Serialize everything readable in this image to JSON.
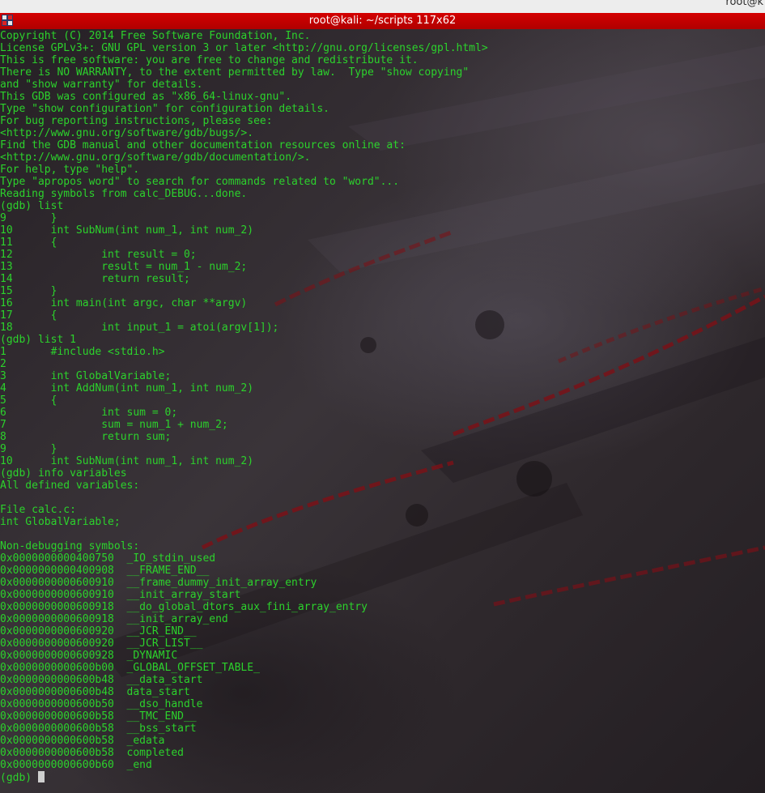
{
  "desktop": {
    "top_right_text": "root@k"
  },
  "window": {
    "title": "root@kali: ~/scripts 117x62",
    "icon": "terminal-icon",
    "titlebar_color": "#c80000"
  },
  "terminal": {
    "text_color": "#2cd22c",
    "lines": [
      "Copyright (C) 2014 Free Software Foundation, Inc.",
      "License GPLv3+: GNU GPL version 3 or later <http://gnu.org/licenses/gpl.html>",
      "This is free software: you are free to change and redistribute it.",
      "There is NO WARRANTY, to the extent permitted by law.  Type \"show copying\"",
      "and \"show warranty\" for details.",
      "This GDB was configured as \"x86_64-linux-gnu\".",
      "Type \"show configuration\" for configuration details.",
      "For bug reporting instructions, please see:",
      "<http://www.gnu.org/software/gdb/bugs/>.",
      "Find the GDB manual and other documentation resources online at:",
      "<http://www.gnu.org/software/gdb/documentation/>.",
      "For help, type \"help\".",
      "Type \"apropos word\" to search for commands related to \"word\"...",
      "Reading symbols from calc_DEBUG...done.",
      "(gdb) list",
      "9\t}",
      "10\tint SubNum(int num_1, int num_2)",
      "11\t{",
      "12\t\tint result = 0;",
      "13\t\tresult = num_1 - num_2;",
      "14\t\treturn result;",
      "15\t}",
      "16\tint main(int argc, char **argv)",
      "17\t{",
      "18\t\tint input_1 = atoi(argv[1]);",
      "(gdb) list 1",
      "1\t#include <stdio.h>",
      "2",
      "3\tint GlobalVariable;",
      "4\tint AddNum(int num_1, int num_2)",
      "5\t{",
      "6\t\tint sum = 0;",
      "7\t\tsum = num_1 + num_2;",
      "8\t\treturn sum;",
      "9\t}",
      "10\tint SubNum(int num_1, int num_2)",
      "(gdb) info variables",
      "All defined variables:",
      "",
      "File calc.c:",
      "int GlobalVariable;",
      "",
      "Non-debugging symbols:",
      "0x0000000000400750  _IO_stdin_used",
      "0x0000000000400908  __FRAME_END__",
      "0x0000000000600910  __frame_dummy_init_array_entry",
      "0x0000000000600910  __init_array_start",
      "0x0000000000600918  __do_global_dtors_aux_fini_array_entry",
      "0x0000000000600918  __init_array_end",
      "0x0000000000600920  __JCR_END__",
      "0x0000000000600920  __JCR_LIST__",
      "0x0000000000600928  _DYNAMIC",
      "0x0000000000600b00  _GLOBAL_OFFSET_TABLE_",
      "0x0000000000600b48  __data_start",
      "0x0000000000600b48  data_start",
      "0x0000000000600b50  __dso_handle",
      "0x0000000000600b58  __TMC_END__",
      "0x0000000000600b58  __bss_start",
      "0x0000000000600b58  _edata",
      "0x0000000000600b58  completed",
      "0x0000000000600b60  _end"
    ],
    "prompt": "(gdb) "
  }
}
